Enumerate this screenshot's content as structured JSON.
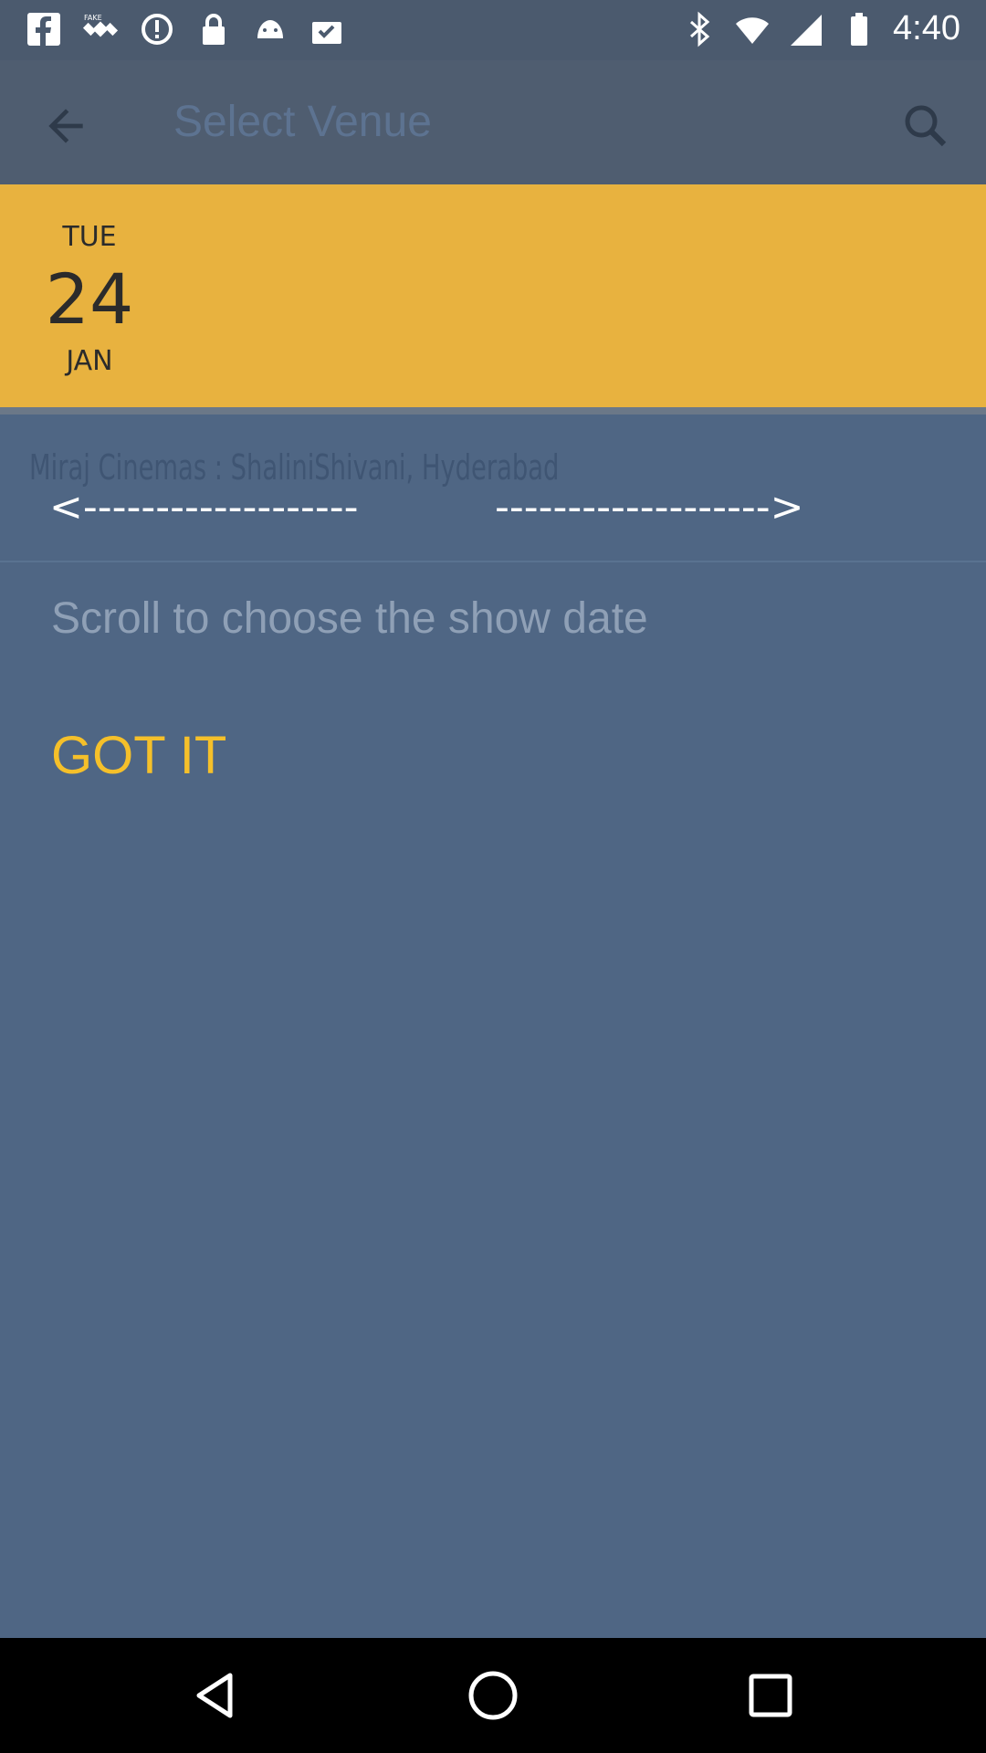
{
  "status_bar": {
    "time": "4:40",
    "left_icons": [
      "facebook-icon",
      "fake-gps-icon",
      "data-saver-icon",
      "lock-icon",
      "android-icon",
      "checklist-icon"
    ],
    "right_icons": [
      "bluetooth-icon",
      "wifi-icon",
      "signal-icon",
      "battery-icon"
    ]
  },
  "app_bar": {
    "title": "Select Venue",
    "back_icon": "arrow-back-icon",
    "search_icon": "search-icon"
  },
  "date_strip": {
    "selected": {
      "day_of_week": "TUE",
      "day": "24",
      "month": "JAN"
    }
  },
  "venue": {
    "name": "Miraj Cinemas : ShaliniShivani, Hyderabad"
  },
  "tutorial": {
    "left_arrow": "<-------------------",
    "right_arrow": "------------------->",
    "hint": "Scroll to choose the show date",
    "dismiss_label": "GOT IT"
  },
  "colors": {
    "app_bar": "#4f5d70",
    "date_strip": "#e8b23f",
    "overlay": "#4f6684",
    "accent": "#f5c02a"
  },
  "nav_bar": {
    "icons": [
      "nav-back-icon",
      "nav-home-icon",
      "nav-recents-icon"
    ]
  }
}
